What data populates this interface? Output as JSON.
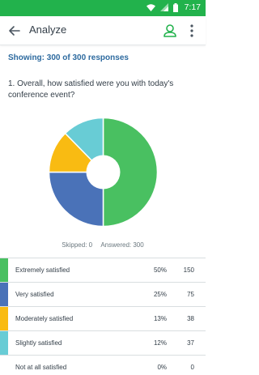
{
  "status_bar": {
    "time": "7:17",
    "color": "#22b24c"
  },
  "header": {
    "title": "Analyze",
    "back_icon": "arrow-left-icon",
    "user_icon": "person-icon",
    "more_icon": "more-vertical-icon"
  },
  "showing": "Showing: 300 of 300 responses",
  "question": "1. Overall, how satisfied were you with today's conference event?",
  "chart_data": {
    "type": "pie",
    "donut": true,
    "labels": [
      "Extremely satisfied",
      "Very satisfied",
      "Moderately satisfied",
      "Slightly satisfied",
      "Not at all satisfied"
    ],
    "values": [
      150,
      75,
      38,
      37,
      0
    ],
    "percents": [
      50,
      25,
      13,
      12,
      0
    ],
    "colors": [
      "#49c061",
      "#4a72b8",
      "#f9bb12",
      "#68ccd5",
      "#d0d5d8"
    ]
  },
  "footer": {
    "skipped": "Skipped: 0",
    "answered": "Answered: 300"
  },
  "rows": [
    {
      "label": "Extremely satisfied",
      "pct": "50%",
      "count": "150",
      "color": "#49c061"
    },
    {
      "label": "Very satisfied",
      "pct": "25%",
      "count": "75",
      "color": "#4a72b8"
    },
    {
      "label": "Moderately satisfied",
      "pct": "13%",
      "count": "38",
      "color": "#f9bb12"
    },
    {
      "label": "Slightly satisfied",
      "pct": "12%",
      "count": "37",
      "color": "#68ccd5"
    },
    {
      "label": "Not at all satisfied",
      "pct": "0%",
      "count": "0",
      "color": ""
    }
  ]
}
